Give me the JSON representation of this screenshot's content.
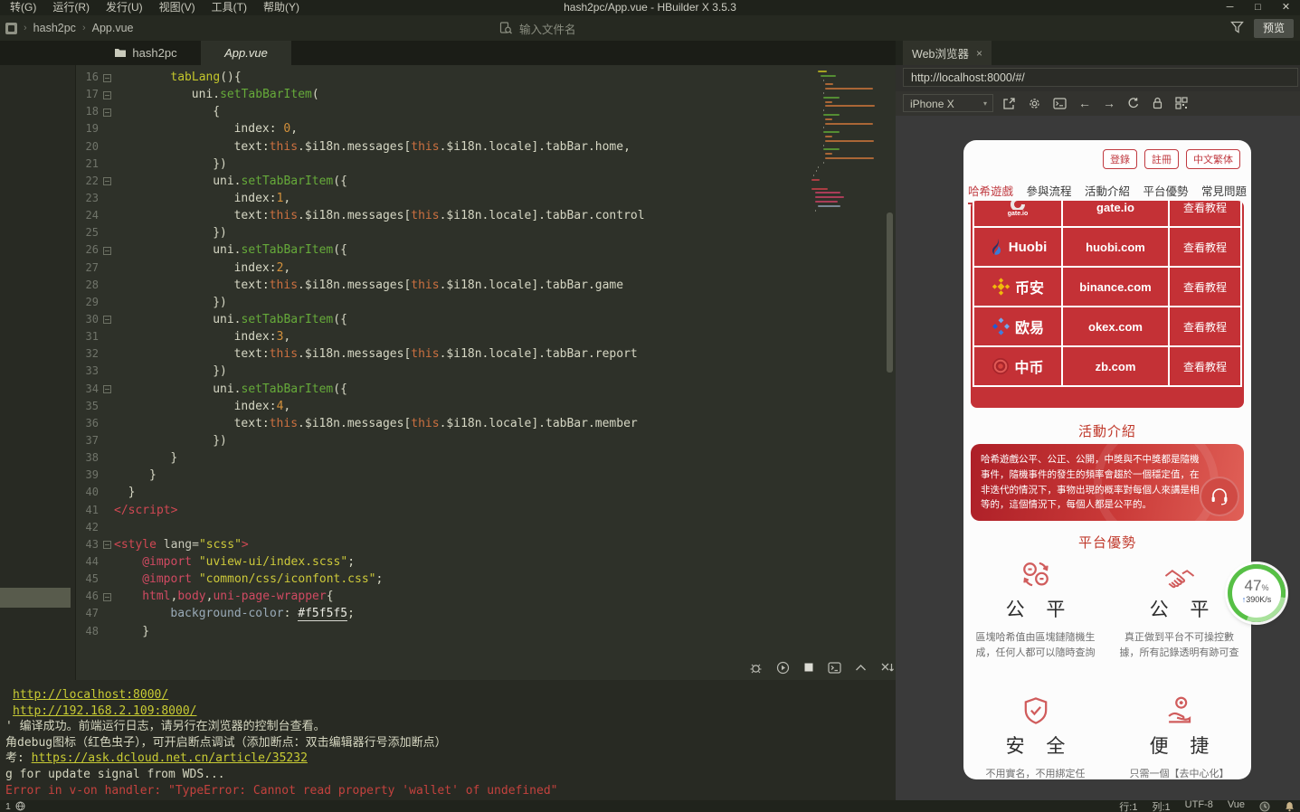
{
  "window": {
    "title": "hash2pc/App.vue - HBuilder X 3.5.3",
    "menus": [
      "转(G)",
      "运行(R)",
      "发行(U)",
      "视图(V)",
      "工具(T)",
      "帮助(Y)"
    ],
    "controls": [
      "─",
      "□",
      "✕"
    ]
  },
  "toolbar": {
    "breadcrumb": [
      "hash2pc",
      "App.vue"
    ],
    "crumb_sep": "›",
    "search_placeholder": "输入文件名",
    "preview_label": "预览"
  },
  "tabs": [
    {
      "label": "hash2pc",
      "icon": "folder",
      "active": false
    },
    {
      "label": "App.vue",
      "active": true
    }
  ],
  "editor": {
    "lines": [
      {
        "n": 16,
        "f": 1,
        "i": 8,
        "t": [
          [
            "tabLang",
            "fn"
          ],
          [
            "(){",
            "pl"
          ]
        ]
      },
      {
        "n": 17,
        "f": 1,
        "i": 11,
        "t": [
          [
            "uni.",
            "pl"
          ],
          [
            "setTabBarItem",
            "mt"
          ],
          [
            "(",
            "pl"
          ]
        ]
      },
      {
        "n": 18,
        "f": 1,
        "i": 14,
        "t": [
          [
            "{",
            "pl"
          ]
        ]
      },
      {
        "n": 19,
        "i": 17,
        "t": [
          [
            "index: ",
            "pl"
          ],
          [
            "0",
            "num"
          ],
          [
            ",",
            "pl"
          ]
        ]
      },
      {
        "n": 20,
        "i": 17,
        "t": [
          [
            "text:",
            "pl"
          ],
          [
            "this",
            "kw"
          ],
          [
            ".$i18n.messages[",
            "pl"
          ],
          [
            "this",
            "kw"
          ],
          [
            ".$i18n.locale].tabBar.home,",
            "pl"
          ]
        ]
      },
      {
        "n": 21,
        "i": 14,
        "t": [
          [
            "})",
            "pl"
          ]
        ]
      },
      {
        "n": 22,
        "f": 1,
        "i": 14,
        "t": [
          [
            "uni.",
            "pl"
          ],
          [
            "setTabBarItem",
            "mt"
          ],
          [
            "({",
            "pl"
          ]
        ]
      },
      {
        "n": 23,
        "i": 17,
        "t": [
          [
            "index:",
            "pl"
          ],
          [
            "1",
            "num"
          ],
          [
            ",",
            "pl"
          ]
        ]
      },
      {
        "n": 24,
        "i": 17,
        "t": [
          [
            "text:",
            "pl"
          ],
          [
            "this",
            "kw"
          ],
          [
            ".$i18n.messages[",
            "pl"
          ],
          [
            "this",
            "kw"
          ],
          [
            ".$i18n.locale].tabBar.control",
            "pl"
          ]
        ]
      },
      {
        "n": 25,
        "i": 14,
        "t": [
          [
            "})",
            "pl"
          ]
        ]
      },
      {
        "n": 26,
        "f": 1,
        "i": 14,
        "t": [
          [
            "uni.",
            "pl"
          ],
          [
            "setTabBarItem",
            "mt"
          ],
          [
            "({",
            "pl"
          ]
        ]
      },
      {
        "n": 27,
        "i": 17,
        "t": [
          [
            "index:",
            "pl"
          ],
          [
            "2",
            "num"
          ],
          [
            ",",
            "pl"
          ]
        ]
      },
      {
        "n": 28,
        "i": 17,
        "t": [
          [
            "text:",
            "pl"
          ],
          [
            "this",
            "kw"
          ],
          [
            ".$i18n.messages[",
            "pl"
          ],
          [
            "this",
            "kw"
          ],
          [
            ".$i18n.locale].tabBar.game",
            "pl"
          ]
        ]
      },
      {
        "n": 29,
        "i": 14,
        "t": [
          [
            "})",
            "pl"
          ]
        ]
      },
      {
        "n": 30,
        "f": 1,
        "i": 14,
        "t": [
          [
            "uni.",
            "pl"
          ],
          [
            "setTabBarItem",
            "mt"
          ],
          [
            "({",
            "pl"
          ]
        ]
      },
      {
        "n": 31,
        "i": 17,
        "t": [
          [
            "index:",
            "pl"
          ],
          [
            "3",
            "num"
          ],
          [
            ",",
            "pl"
          ]
        ]
      },
      {
        "n": 32,
        "i": 17,
        "t": [
          [
            "text:",
            "pl"
          ],
          [
            "this",
            "kw"
          ],
          [
            ".$i18n.messages[",
            "pl"
          ],
          [
            "this",
            "kw"
          ],
          [
            ".$i18n.locale].tabBar.report",
            "pl"
          ]
        ]
      },
      {
        "n": 33,
        "i": 14,
        "t": [
          [
            "})",
            "pl"
          ]
        ]
      },
      {
        "n": 34,
        "f": 1,
        "i": 14,
        "t": [
          [
            "uni.",
            "pl"
          ],
          [
            "setTabBarItem",
            "mt"
          ],
          [
            "({",
            "pl"
          ]
        ]
      },
      {
        "n": 35,
        "i": 17,
        "t": [
          [
            "index:",
            "pl"
          ],
          [
            "4",
            "num"
          ],
          [
            ",",
            "pl"
          ]
        ]
      },
      {
        "n": 36,
        "i": 17,
        "t": [
          [
            "text:",
            "pl"
          ],
          [
            "this",
            "kw"
          ],
          [
            ".$i18n.messages[",
            "pl"
          ],
          [
            "this",
            "kw"
          ],
          [
            ".$i18n.locale].tabBar.member",
            "pl"
          ]
        ]
      },
      {
        "n": 37,
        "i": 14,
        "t": [
          [
            "})",
            "pl"
          ]
        ]
      },
      {
        "n": 38,
        "i": 8,
        "t": [
          [
            "}",
            "pl"
          ]
        ]
      },
      {
        "n": 39,
        "i": 5,
        "t": [
          [
            "}",
            "pl"
          ]
        ]
      },
      {
        "n": 40,
        "i": 2,
        "t": [
          [
            "}",
            "pl"
          ]
        ]
      },
      {
        "n": 41,
        "i": 0,
        "t": [
          [
            "</script>",
            "tag"
          ]
        ]
      },
      {
        "n": 42,
        "i": 0,
        "t": []
      },
      {
        "n": 43,
        "f": 1,
        "i": 0,
        "t": [
          [
            "<style",
            "tag"
          ],
          [
            " lang=",
            "attr"
          ],
          [
            "\"scss\"",
            "str"
          ],
          [
            ">",
            "tag"
          ]
        ]
      },
      {
        "n": 44,
        "i": 4,
        "t": [
          [
            "@import",
            "at"
          ],
          [
            " ",
            "pl"
          ],
          [
            "\"uview-ui/index.scss\"",
            "str"
          ],
          [
            ";",
            "pl"
          ]
        ]
      },
      {
        "n": 45,
        "i": 4,
        "t": [
          [
            "@import",
            "at"
          ],
          [
            " ",
            "pl"
          ],
          [
            "\"common/css/iconfont.css\"",
            "str"
          ],
          [
            ";",
            "pl"
          ]
        ]
      },
      {
        "n": 46,
        "f": 1,
        "i": 4,
        "t": [
          [
            "html",
            "sel"
          ],
          [
            ",",
            "pl"
          ],
          [
            "body",
            "sel"
          ],
          [
            ",",
            "pl"
          ],
          [
            "uni-page-wrapper",
            "sel"
          ],
          [
            "{",
            "pl"
          ]
        ]
      },
      {
        "n": 47,
        "i": 8,
        "t": [
          [
            "background-color",
            "prop"
          ],
          [
            ": ",
            "pl"
          ],
          [
            "#f5f5f5",
            "hex"
          ],
          [
            ";",
            "pl"
          ]
        ]
      },
      {
        "n": 48,
        "i": 4,
        "t": [
          [
            "}",
            "pl"
          ]
        ]
      }
    ]
  },
  "console": {
    "lines": [
      {
        "ind": true,
        "parts": [
          [
            "http://localhost:8000/",
            "link"
          ]
        ]
      },
      {
        "ind": true,
        "parts": [
          [
            "http://192.168.2.109:8000/",
            "link"
          ]
        ]
      },
      {
        "ind": false,
        "parts": [
          [
            "' 编译成功。前端运行日志，请另行在浏览器的控制台查看。",
            "txt"
          ]
        ]
      },
      {
        "ind": false,
        "parts": [
          [
            "角debug图标（红色虫子），可开启断点调试（添加断点：双击编辑器行号添加断点）",
            "txt"
          ]
        ]
      },
      {
        "ind": false,
        "parts": [
          [
            "考: ",
            "txt"
          ],
          [
            "https://ask.dcloud.net.cn/article/35232",
            "link"
          ]
        ]
      },
      {
        "ind": false,
        "parts": [
          [
            "g for update signal from WDS...",
            "txt"
          ]
        ]
      },
      {
        "ind": false,
        "parts": [
          [
            "Error in v-on handler: \"TypeError: Cannot read property 'wallet' of undefined\"",
            "err"
          ]
        ]
      }
    ]
  },
  "statusbar": {
    "problems": "1",
    "items": [
      "行:1",
      "列:1",
      "UTF-8",
      "Vue"
    ]
  },
  "browser": {
    "tab_label": "Web浏览器",
    "close": "×",
    "url": "http://localhost:8000/#/",
    "device": "iPhone X",
    "caret": "▾",
    "back": "←",
    "forward": "→"
  },
  "preview": {
    "auth_buttons": [
      "登錄",
      "註冊",
      "中文繁体"
    ],
    "nav_tabs": [
      {
        "label": "哈希遊戲",
        "active": true
      },
      {
        "label": "參與流程",
        "active": false
      },
      {
        "label": "活動介紹",
        "active": false
      },
      {
        "label": "平台優勢",
        "active": false
      },
      {
        "label": "常見問題",
        "active": false
      }
    ],
    "action_label": "查看教程",
    "exchanges": [
      {
        "logo": "gate",
        "logo_text": "gate.io",
        "domain": "gate.io"
      },
      {
        "logo": "huobi",
        "logo_text": "Huobi",
        "domain": "huobi.com"
      },
      {
        "logo": "binance",
        "logo_text": "币安",
        "domain": "binance.com"
      },
      {
        "logo": "okex",
        "logo_text": "欧易",
        "domain": "okex.com"
      },
      {
        "logo": "zb",
        "logo_text": "中币",
        "domain": "zb.com"
      }
    ],
    "activity_title": "活動介紹",
    "activity_text": "哈希遊戲公平、公正、公開，中獎與不中獎都是隨機事件，隨機事件的發生的頻率會趨於一個穩定值，在非迭代的情況下，事物出現的概率對每個人來講是相等的，這個情況下，每個人都是公平的。",
    "advantage_title": "平台優勢",
    "features": [
      {
        "icon": "coins-swap-icon",
        "title": "公 平",
        "desc": "區塊哈希值由區塊鏈隨機生成，任何人都可以隨時查詢"
      },
      {
        "icon": "handshake-icon",
        "title": "公 平",
        "desc": "真正做到平台不可操控數據，所有記錄透明有跡可查"
      },
      {
        "icon": "shield-check-icon",
        "title": "安 全",
        "desc": "不用實名，不用綁定任"
      },
      {
        "icon": "coin-hand-icon",
        "title": "便 捷",
        "desc": "只需一個【去中心化】"
      }
    ]
  },
  "badge": {
    "percent": "47",
    "symbol": "%",
    "arrow": "↑",
    "speed": "390K/s"
  },
  "colors": {
    "accent_red": "#c43136",
    "link_yellow": "#c9cc34",
    "error_red": "#c4423e",
    "badge_green": "#57c046",
    "editor_bg": "#2e3129"
  }
}
